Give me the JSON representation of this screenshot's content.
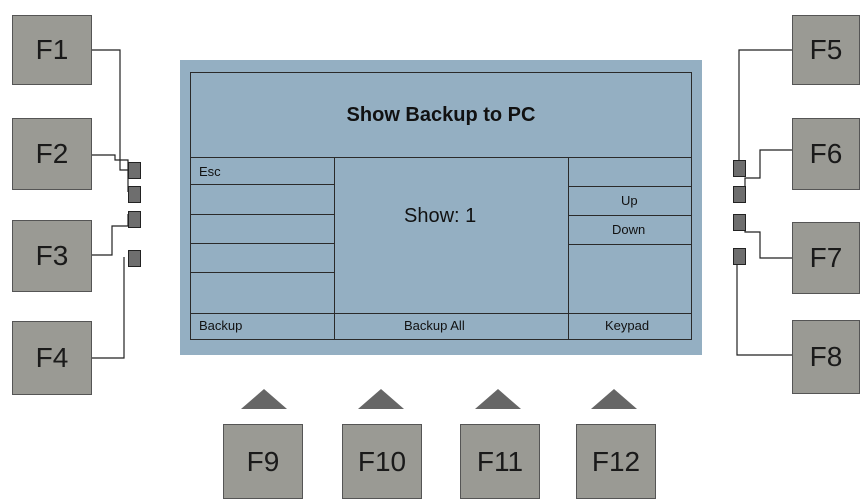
{
  "screen": {
    "title": "Show Backup to PC",
    "center_text": "Show: 1",
    "left_labels": [
      "Esc",
      "",
      "",
      "",
      ""
    ],
    "right_labels": [
      "",
      "Up",
      "Down",
      "",
      ""
    ],
    "bottom_labels": [
      "Backup",
      "Backup All",
      "Keypad"
    ]
  },
  "keys": {
    "left": [
      "F1",
      "F2",
      "F3",
      "F4"
    ],
    "right": [
      "F5",
      "F6",
      "F7",
      "F8"
    ],
    "bottom": [
      "F9",
      "F10",
      "F11",
      "F12"
    ]
  },
  "colors": {
    "screen_bg": "#94afc2",
    "key_bg": "#9a9a94",
    "button_fill": "#6e6e6e",
    "arrow_fill": "#666666"
  }
}
